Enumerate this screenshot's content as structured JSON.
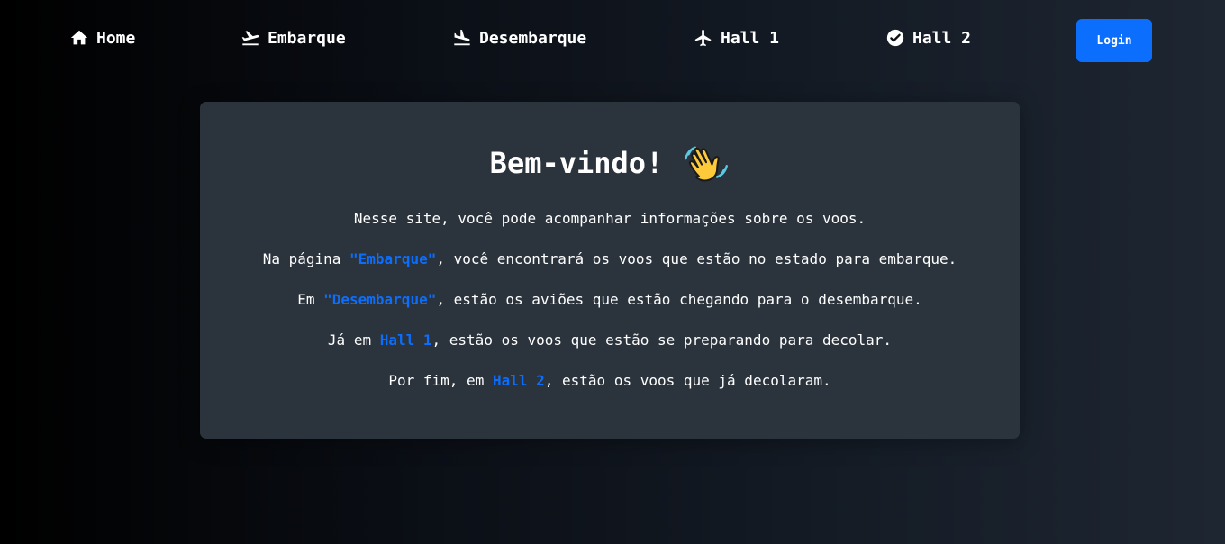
{
  "nav": {
    "home": "Home",
    "embarque": "Embarque",
    "desembarque": "Desembarque",
    "hall1": "Hall 1",
    "hall2": "Hall 2",
    "login": "Login"
  },
  "welcome": {
    "title": "Bem-vindo!",
    "line1": "Nesse site, você pode acompanhar informações sobre os voos.",
    "line2_pre": "Na página ",
    "line2_link": "\"Embarque\"",
    "line2_post": ", você encontrará os voos que estão no estado para embarque.",
    "line3_pre": "Em ",
    "line3_link": "\"Desembarque\"",
    "line3_post": ", estão os aviões que estão chegando para o desembarque.",
    "line4_pre": "Já em ",
    "line4_link": "Hall 1",
    "line4_post": ", estão os voos que estão se preparando para decolar.",
    "line5_pre": "Por fim, em ",
    "line5_link": "Hall 2",
    "line5_post": ", estão os voos que já decolaram."
  },
  "colors": {
    "accent": "#0b6efd",
    "card": "#2b333c"
  },
  "icons": {
    "home": "home-icon",
    "embarque": "airplane-departure-icon",
    "desembarque": "airplane-arrival-icon",
    "hall1": "airplane-icon",
    "hall2": "check-circle-icon",
    "title": "waving-hand-icon"
  }
}
